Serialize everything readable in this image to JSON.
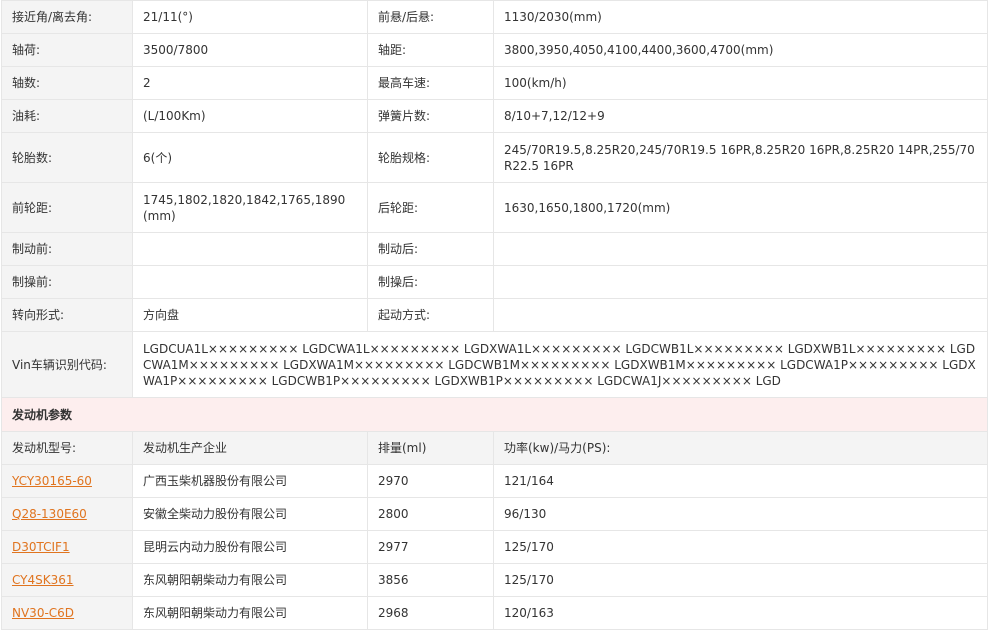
{
  "specs": [
    {
      "l1": "接近角/离去角:",
      "v1": "21/11(°)",
      "l2": "前悬/后悬:",
      "v2": "1130/2030(mm)"
    },
    {
      "l1": "轴荷:",
      "v1": "3500/7800",
      "l2": "轴距:",
      "v2": "3800,3950,4050,4100,4400,3600,4700(mm)"
    },
    {
      "l1": "轴数:",
      "v1": "2",
      "l2": "最高车速:",
      "v2": "100(km/h)"
    },
    {
      "l1": "油耗:",
      "v1": "(L/100Km)",
      "l2": "弹簧片数:",
      "v2": "8/10+7,12/12+9"
    },
    {
      "l1": "轮胎数:",
      "v1": "6(个)",
      "l2": "轮胎规格:",
      "v2": "245/70R19.5,8.25R20,245/70R19.5 16PR,8.25R20 16PR,8.25R20 14PR,255/70R22.5 16PR"
    },
    {
      "l1": "前轮距:",
      "v1": "1745,1802,1820,1842,1765,1890(mm)",
      "l2": "后轮距:",
      "v2": "1630,1650,1800,1720(mm)"
    },
    {
      "l1": "制动前:",
      "v1": "",
      "l2": "制动后:",
      "v2": ""
    },
    {
      "l1": "制操前:",
      "v1": "",
      "l2": "制操后:",
      "v2": ""
    },
    {
      "l1": "转向形式:",
      "v1": "方向盘",
      "l2": "起动方式:",
      "v2": ""
    }
  ],
  "vin": {
    "label": "Vin车辆识别代码:",
    "value": "LGDCUA1L××××××××× LGDCWA1L××××××××× LGDXWA1L××××××××× LGDCWB1L××××××××× LGDXWB1L××××××××× LGDCWA1M××××××××× LGDXWA1M××××××××× LGDCWB1M××××××××× LGDXWB1M××××××××× LGDCWA1P××××××××× LGDXWA1P××××××××× LGDCWB1P××××××××× LGDXWB1P××××××××× LGDCWA1J××××××××× LGD"
  },
  "engine_section": {
    "title": "发动机参数",
    "headers": [
      "发动机型号:",
      "发动机生产企业",
      "排量(ml)",
      "功率(kw)/马力(PS):"
    ],
    "rows": [
      {
        "model": "YCY30165-60",
        "maker": "广西玉柴机器股份有限公司",
        "displacement": "2970",
        "power": "121/164"
      },
      {
        "model": "Q28-130E60",
        "maker": "安徽全柴动力股份有限公司",
        "displacement": "2800",
        "power": "96/130"
      },
      {
        "model": "D30TCIF1",
        "maker": "昆明云内动力股份有限公司",
        "displacement": "2977",
        "power": "125/170"
      },
      {
        "model": "CY4SK361",
        "maker": "东风朝阳朝柴动力有限公司",
        "displacement": "3856",
        "power": "125/170"
      },
      {
        "model": "NV30-C6D",
        "maker": "东风朝阳朝柴动力有限公司",
        "displacement": "2968",
        "power": "120/163"
      }
    ]
  },
  "colors": {
    "link": "#e0741f",
    "label_bg": "#f4f4f4",
    "section_bg": "#fdeeee",
    "border": "#e6e6e6"
  }
}
